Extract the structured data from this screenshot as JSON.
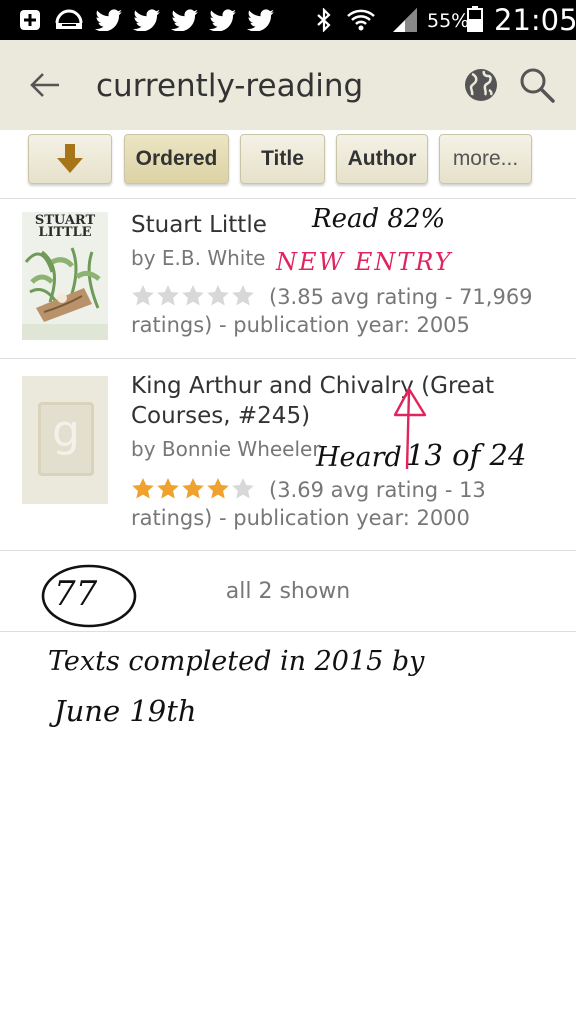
{
  "status_bar": {
    "battery_percent": "55%",
    "time": "21:05",
    "icons": [
      "add-icon",
      "tray-icon",
      "twitter-icon",
      "twitter-icon",
      "twitter-icon",
      "twitter-icon",
      "twitter-icon",
      "bluetooth-icon",
      "wifi-icon",
      "signal-icon",
      "battery-icon"
    ]
  },
  "app_bar": {
    "title": "currently-reading",
    "icons": [
      "back-arrow-icon",
      "globe-icon",
      "search-icon"
    ]
  },
  "sort_bar": {
    "buttons": [
      "Ordered",
      "Title",
      "Author",
      "more..."
    ],
    "active": "Ordered"
  },
  "books": [
    {
      "title": "Stuart Little",
      "author": "by E.B. White",
      "cover_title": "STUART LITTLE",
      "rating_stars": 0,
      "rating_text": "(3.85 avg rating - 71,969 ratings) - publication year: 2005"
    },
    {
      "title": "King Arthur and Chivalry (Great Courses, #245)",
      "author": "by Bonnie Wheeler",
      "cover_letter": "g",
      "rating_stars": 4,
      "rating_text": "(3.69 avg rating - 13 ratings) - publication year: 2000"
    }
  ],
  "footer": {
    "shown": "all 2 shown"
  },
  "annotations": {
    "read": "Read 82%",
    "new_entry": "NEW ENTRY",
    "heard": "Heard",
    "fraction": "13 of 24",
    "circled_number": "77",
    "note_line1": "Texts completed in 2015 by",
    "note_line2": "June 19th"
  },
  "colors": {
    "app_bar_bg": "#ebe8dc",
    "star_on": "#f0a22e",
    "star_off": "#d8d8d8",
    "annotation_red": "#e0245e"
  }
}
